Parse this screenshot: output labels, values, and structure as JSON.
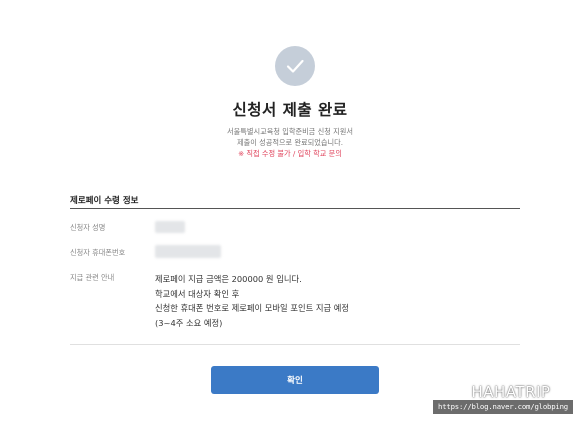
{
  "header": {
    "icon": "check-icon",
    "icon_color": "#c5ced9",
    "title": "신청서 제출 완료",
    "subtitle_line1": "서울특별시교육청 입학준비금 신청 지원서",
    "subtitle_line2": "제출이 성공적으로 완료되었습니다.",
    "warning": "※ 직접 수정 불가 / 입학 학교 문의",
    "warning_color": "#e0445c"
  },
  "section": {
    "title": "제로페이 수령 정보",
    "rows": [
      {
        "label": "신청자 성명"
      },
      {
        "label": "신청자 휴대폰번호"
      },
      {
        "label": "지급 관련 안내"
      }
    ],
    "info_lines": [
      "제로페이 지급 금액은 200000 원 입니다.",
      "학교에서 대상자 확인 후",
      "신청한 휴대폰 번호로 제로페이 모바일 포인트 지급 예정",
      "(3~4주 소요 예정)"
    ]
  },
  "confirm_button": {
    "label": "확인",
    "color": "#3b7ac6"
  },
  "watermark": {
    "title": "HAHATRIP",
    "url": "https://blog.naver.com/globping"
  }
}
